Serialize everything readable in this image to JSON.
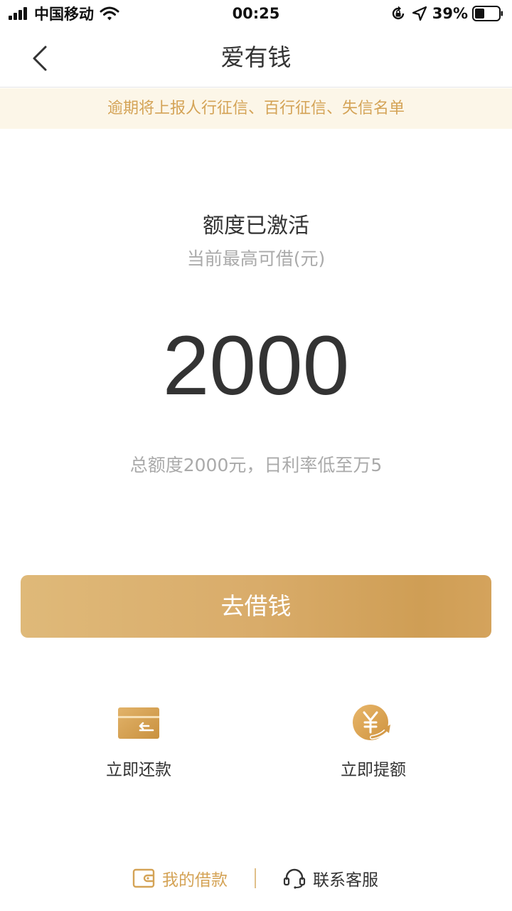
{
  "status_bar": {
    "carrier": "中国移动",
    "time": "00:25",
    "battery": "39%"
  },
  "nav": {
    "title": "爱有钱"
  },
  "banner": {
    "text": "逾期将上报人行征信、百行征信、失信名单"
  },
  "credit": {
    "status": "额度已激活",
    "label": "当前最高可借(元)",
    "amount": "2000",
    "note": "总额度2000元，日利率低至万5"
  },
  "main_button": {
    "label": "去借钱"
  },
  "actions": {
    "repay": {
      "label": "立即还款",
      "icon": "wallet-card-icon"
    },
    "raise": {
      "label": "立即提额",
      "icon": "yuan-coin-up-icon"
    }
  },
  "footer": {
    "my_loans": {
      "label": "我的借款",
      "icon": "wallet-icon"
    },
    "service": {
      "label": "联系客服",
      "icon": "headset-icon"
    }
  },
  "colors": {
    "accent": "#d4a356",
    "banner_bg": "#fcf6e8",
    "button_start": "#dfb979",
    "button_end": "#cf9e55"
  }
}
